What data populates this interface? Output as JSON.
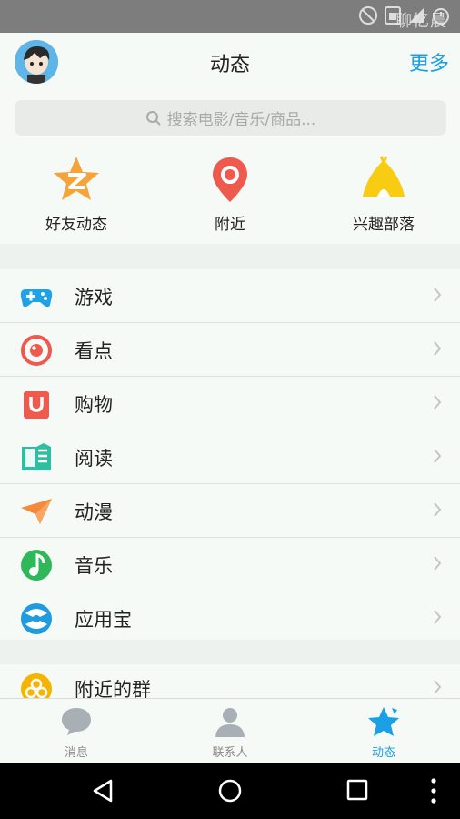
{
  "status": {
    "watermark": "聊忆晨"
  },
  "header": {
    "title": "动态",
    "more": "更多"
  },
  "search": {
    "placeholder": "搜索电影/音乐/商品..."
  },
  "quick": [
    {
      "label": "好友动态",
      "icon": "qzone-star-icon"
    },
    {
      "label": "附近",
      "icon": "location-pin-icon"
    },
    {
      "label": "兴趣部落",
      "icon": "tent-icon"
    }
  ],
  "list": [
    {
      "label": "游戏",
      "icon": "gamepad-icon"
    },
    {
      "label": "看点",
      "icon": "eye-target-icon"
    },
    {
      "label": "购物",
      "icon": "shopping-bag-icon"
    },
    {
      "label": "阅读",
      "icon": "book-icon"
    },
    {
      "label": "动漫",
      "icon": "paper-plane-icon"
    },
    {
      "label": "音乐",
      "icon": "music-note-icon"
    },
    {
      "label": "应用宝",
      "icon": "app-store-icon"
    }
  ],
  "list2": [
    {
      "label": "附近的群",
      "icon": "group-icon"
    }
  ],
  "tabs": [
    {
      "label": "消息",
      "icon": "chat-bubble-icon"
    },
    {
      "label": "联系人",
      "icon": "person-icon"
    },
    {
      "label": "动态",
      "icon": "star-icon",
      "active": true
    }
  ],
  "colors": {
    "accent": "#1ba0e8",
    "statusbar": "#7d7d7d",
    "navbar": "#000000"
  }
}
